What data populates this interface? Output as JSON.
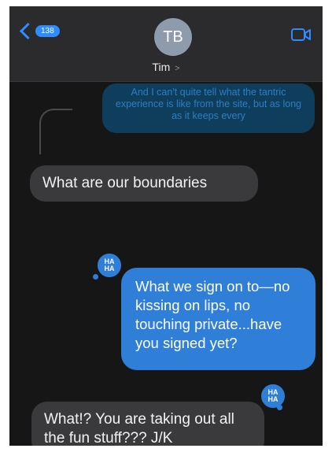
{
  "header": {
    "back_count": "138",
    "avatar_initials": "TB",
    "contact_name": "Tim",
    "contact_chevron": ">"
  },
  "messages": [
    {
      "direction": "outgoing",
      "text": "And I can't quite tell what the tantric experience is like from the site, but as long as it keeps every"
    },
    {
      "direction": "incoming",
      "text": "What are our boundaries"
    },
    {
      "direction": "outgoing",
      "text": "What we sign on to—no kissing on lips, no touching private...have you signed yet?",
      "reaction": "HA HA"
    },
    {
      "direction": "incoming",
      "text": "What!? You are taking out all the fun stuff??? J/K",
      "reaction": "HA HA"
    }
  ],
  "reaction_label": {
    "line1": "HA",
    "line2": "HA"
  },
  "colors": {
    "accent": "#2f8cff",
    "outgoing_bubble": "#2f7ed8",
    "incoming_bubble": "#3a3a3c",
    "background": "#161616",
    "header": "#2b2b2d"
  },
  "icons": [
    "back-chevron-icon",
    "video-camera-icon",
    "haha-reaction-icon"
  ]
}
